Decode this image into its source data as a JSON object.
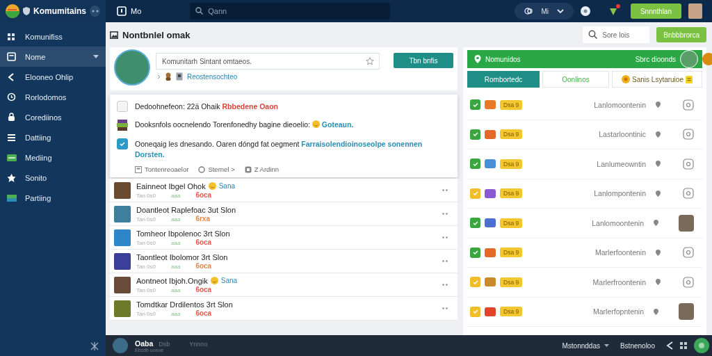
{
  "topbar": {
    "brand": "Komumitains",
    "section": "Mo",
    "search": {
      "placeholder": "Qann"
    },
    "pill_label": "Mi",
    "action_button": "Snnnthlan",
    "notification": true
  },
  "sidebar": {
    "items": [
      {
        "label": "Komunifiss",
        "selected": false,
        "expandable": false
      },
      {
        "label": "Nome",
        "selected": true,
        "expandable": true
      },
      {
        "label": "Elooneo Ohlip",
        "selected": false,
        "expandable": false
      },
      {
        "label": "Rorlodomos",
        "selected": false,
        "expandable": false
      },
      {
        "label": "Corediinos",
        "selected": false,
        "expandable": false
      },
      {
        "label": "Dattiing",
        "selected": false,
        "expandable": false
      },
      {
        "label": "Mediing",
        "selected": false,
        "expandable": false
      },
      {
        "label": "Sonito",
        "selected": false,
        "expandable": false
      },
      {
        "label": "Partiing",
        "selected": false,
        "expandable": false
      }
    ]
  },
  "page": {
    "title": "Nontbnlel omak",
    "search": {
      "placeholder": "Sore lois"
    },
    "button": "Bnbbbrorca"
  },
  "composer": {
    "placeholder": "Komunitarh Sintant omtaeos.",
    "button": "Tbn bnfis",
    "link": "Reostensochteo"
  },
  "dropdown": {
    "items": [
      {
        "kind": "checkbox",
        "checked": false,
        "text": "Dedoohnefeon: 22ä Ohaik",
        "link": "Rbbedene Oaon",
        "color": "#d9443a"
      },
      {
        "kind": "thumb",
        "text": "Dooksnfols oocnelendo Torenfonedhy bagine dieoelio:",
        "emoji": true,
        "link": "Goteaun.",
        "color": "#2a8fb5"
      },
      {
        "kind": "checkbox",
        "checked": true,
        "text": "Ooneqaig les dnesando. Oaren dóngd fat oegment",
        "link": "Farraisolendioinoseolpe sonennen Dorsten.",
        "color": "#2a8fb5"
      }
    ],
    "actions": [
      "Tontenreoaelor",
      "Sternel >",
      "Z Ardinn"
    ]
  },
  "posts": [
    {
      "title": "Eainneot Ibgel Ohok",
      "tag": "Sana",
      "meta": "Tan 0s0",
      "label": "aaa",
      "status": "6oca",
      "color": "#e05a4f"
    },
    {
      "title": "Doantleot Raplefoac 3ut Slon",
      "meta": "Tan 0s0",
      "label": "aaa",
      "status": "6rxa",
      "color": "#e0894f"
    },
    {
      "title": "Tomheor Ibpolenoc 3rt Slon",
      "meta": "Tan 0s0",
      "label": "aaa",
      "status": "6oca",
      "color": "#e05a4f"
    },
    {
      "title": "Taontleot Ibolomor 3rt Slon",
      "meta": "Tan 0s0",
      "label": "aaa",
      "status": "6oca",
      "color": "#e0894f"
    },
    {
      "title": "Aontneot Ibjoh.Ongik",
      "tag": "Sana",
      "meta": "Tan 0s0",
      "label": "aaa",
      "status": "6oca",
      "color": "#e05a4f"
    },
    {
      "title": "Tomdtkar Drdilentos 3rt Slon",
      "meta": "Tan 0s0",
      "label": "aaa",
      "status": "6oca",
      "color": "#e05a4f"
    }
  ],
  "panel": {
    "header": "Nomunidos",
    "header_right": "Sbrc dioonds",
    "tabs": [
      {
        "label": "Rombortedc",
        "selected": true
      },
      {
        "label": "Oonlinos",
        "selected": false
      },
      {
        "label": "Sanis Lsytaruioe",
        "selected": false
      }
    ],
    "rows": [
      {
        "color": "#3aa640",
        "badge": "Dsa 9",
        "text": "Lanlomoontenin",
        "kind": "outline"
      },
      {
        "color": "#3aa640",
        "badge": "Dsa 9",
        "text": "Lastarloontinic",
        "kind": "outline"
      },
      {
        "color": "#3aa640",
        "badge": "Dsa 9",
        "text": "Lanlumeowntin",
        "kind": "outline"
      },
      {
        "color": "#f2bd2a",
        "badge": "Dsa 9",
        "text": "Lanlompontenin",
        "kind": "outline"
      },
      {
        "color": "#3aa640",
        "badge": "Dsa 9",
        "text": "Lanlomoontenin",
        "kind": "avatar"
      },
      {
        "color": "#3aa640",
        "badge": "Dsa 9",
        "text": "Marlerfoontenin",
        "kind": "outline"
      },
      {
        "color": "#f2bd2a",
        "badge": "Dsa 9",
        "text": "Marlerfroontenin",
        "kind": "outline"
      },
      {
        "color": "#f2bd2a",
        "badge": "Dsa 9",
        "text": "Marlerfopntenin",
        "kind": "avatar"
      }
    ]
  },
  "footer": {
    "name": "Oaba",
    "tag": "Dsb",
    "extra": "Ynnno",
    "sub": "Ebcdb uonoe",
    "menu": "Mstonnddas",
    "link": "Bstnenoloo"
  }
}
